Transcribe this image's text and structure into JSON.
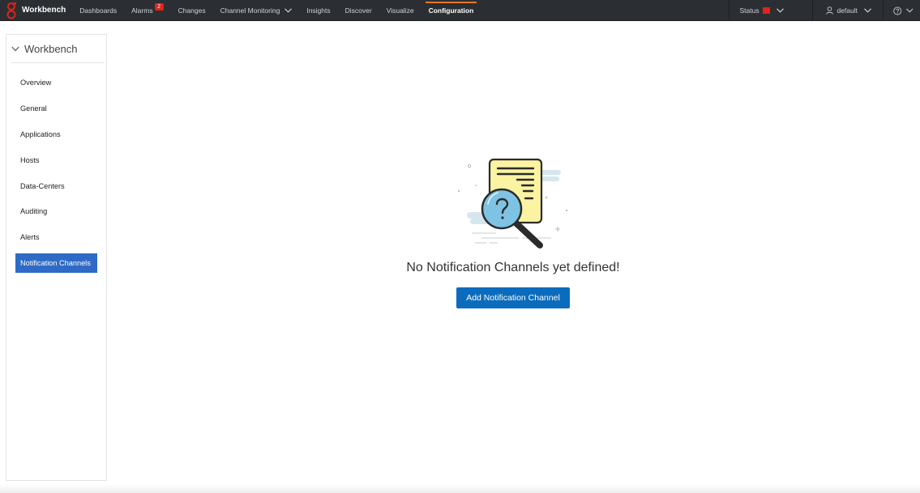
{
  "app": {
    "name": "Workbench"
  },
  "topnav": {
    "items": [
      {
        "label": "Dashboards"
      },
      {
        "label": "Alarms",
        "badge": "2"
      },
      {
        "label": "Changes"
      },
      {
        "label": "Channel Monitoring"
      },
      {
        "label": "Insights"
      },
      {
        "label": "Discover"
      },
      {
        "label": "Visualize"
      },
      {
        "label": "Configuration",
        "active": true
      }
    ],
    "status_label": "Status",
    "user_label": "default"
  },
  "sidebar": {
    "title": "Workbench",
    "items": [
      {
        "label": "Overview"
      },
      {
        "label": "General"
      },
      {
        "label": "Applications"
      },
      {
        "label": "Hosts"
      },
      {
        "label": "Data-Centers"
      },
      {
        "label": "Auditing"
      },
      {
        "label": "Alerts"
      },
      {
        "label": "Notification Channels",
        "active": true
      }
    ]
  },
  "main": {
    "empty_message": "No Notification Channels yet defined!",
    "add_button_label": "Add Notification Channel"
  },
  "colors": {
    "topbar_bg": "#2b2f33",
    "active_tab_accent": "#e87722",
    "status_indicator": "#e2231a",
    "sidebar_active_bg": "#2f6bc6",
    "primary_button": "#0b6cbd"
  }
}
